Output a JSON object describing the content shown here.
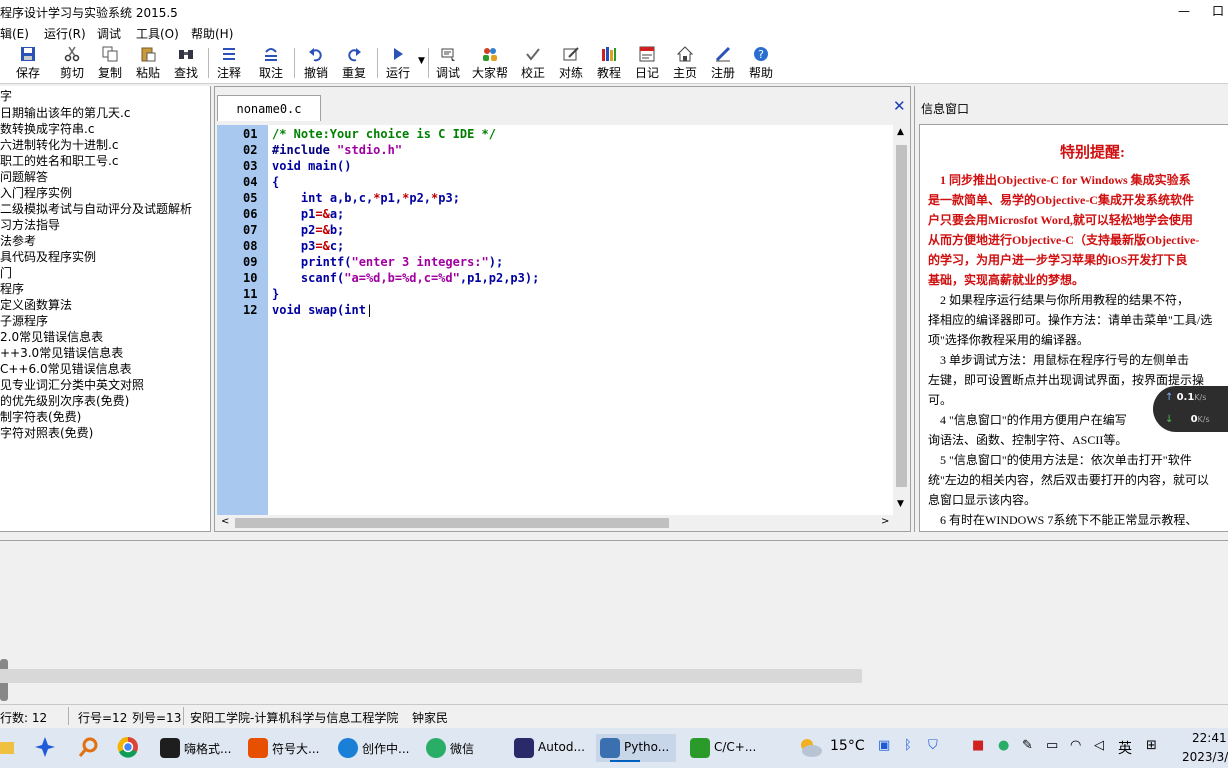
{
  "window": {
    "title": "程序设计学习与实验系统 2015.5",
    "min": "—",
    "max": "口"
  },
  "menu": [
    "辑(E)",
    "运行(R)",
    "调试",
    "工具(O)",
    "帮助(H)"
  ],
  "toolbar": [
    {
      "label": "保存",
      "icon": "save-icon"
    },
    {
      "label": "剪切",
      "icon": "cut-icon"
    },
    {
      "label": "复制",
      "icon": "copy-icon"
    },
    {
      "label": "粘贴",
      "icon": "paste-icon"
    },
    {
      "label": "查找",
      "icon": "find-icon"
    },
    {
      "label": "注释",
      "icon": "comment-icon"
    },
    {
      "label": "取注",
      "icon": "uncomment-icon"
    },
    {
      "label": "撤销",
      "icon": "undo-icon"
    },
    {
      "label": "重复",
      "icon": "redo-icon"
    },
    {
      "label": "运行",
      "icon": "run-icon"
    },
    {
      "label": "调试",
      "icon": "debug-icon"
    },
    {
      "label": "大家帮",
      "icon": "people-icon"
    },
    {
      "label": "校正",
      "icon": "check-icon"
    },
    {
      "label": "对练",
      "icon": "practice-icon"
    },
    {
      "label": "教程",
      "icon": "books-icon"
    },
    {
      "label": "日记",
      "icon": "diary-icon"
    },
    {
      "label": "主页",
      "icon": "home-icon"
    },
    {
      "label": "注册",
      "icon": "register-icon"
    },
    {
      "label": "帮助",
      "icon": "help-icon"
    }
  ],
  "tree": [
    "字",
    "日期输出该年的第几天.c",
    "数转换成字符串.c",
    "六进制转化为十进制.c",
    "职工的姓名和职工号.c",
    "问题解答",
    "入门程序实例",
    "二级模拟考试与自动评分及试题解析",
    "习方法指导",
    "法参考",
    "具代码及程序实例",
    "门",
    "程序",
    "定义函数算法",
    "子源程序",
    "2.0常见错误信息表",
    "++3.0常见错误信息表",
    "C++6.0常见错误信息表",
    "见专业词汇分类中英文对照",
    "的优先级别次序表(免费)",
    "制字符表(免费)",
    "字符对照表(免费)"
  ],
  "editor": {
    "tab": "noname0.c",
    "close": "✕",
    "lines": [
      {
        "n": "01",
        "html": "<span class=\"cm\">/* Note:Your choice is C IDE */</span>"
      },
      {
        "n": "02",
        "html": "<span class=\"pp\">#include</span> <span class=\"str\">\"stdio.h\"</span>"
      },
      {
        "n": "03",
        "html": "<span class=\"kw\">void</span> <span class=\"kw\">main</span><span class=\"kw\">()</span>"
      },
      {
        "n": "04",
        "html": "<span class=\"kw\">{</span>"
      },
      {
        "n": "05",
        "html": "    <span class=\"kw\">int</span> <span class=\"kw\">a,b,c,</span><span class=\"op\">*</span><span class=\"kw\">p1,</span><span class=\"op\">*</span><span class=\"kw\">p2,</span><span class=\"op\">*</span><span class=\"kw\">p3;</span>"
      },
      {
        "n": "06",
        "html": "    <span class=\"kw\">p1</span><span class=\"op\">=&amp;</span><span class=\"kw\">a;</span>"
      },
      {
        "n": "07",
        "html": "    <span class=\"kw\">p2</span><span class=\"op\">=&amp;</span><span class=\"kw\">b;</span>"
      },
      {
        "n": "08",
        "html": "    <span class=\"kw\">p3</span><span class=\"op\">=&amp;</span><span class=\"kw\">c;</span>"
      },
      {
        "n": "09",
        "html": "    <span class=\"kw\">printf(</span><span class=\"str\">\"enter 3 integers:\"</span><span class=\"kw\">);</span>"
      },
      {
        "n": "10",
        "html": "    <span class=\"kw\">scanf(</span><span class=\"str\">\"a=%d,b=%d,c=%d\"</span><span class=\"kw\">,p1,p2,p3);</span>"
      },
      {
        "n": "11",
        "html": "<span class=\"kw\">}</span>"
      },
      {
        "n": "12",
        "html": "<span class=\"kw\">void swap(int</span><span style=\"color:#000;font-weight:normal\">|</span>"
      }
    ]
  },
  "info": {
    "header": "信息窗口",
    "heading": "特别提醒:",
    "paras": [
      {
        "red": true,
        "text": "　1 同步推出Objective-C for Windows 集成实验系"
      },
      {
        "red": true,
        "text": "是一款简单、易学的Objective-C集成开发系统软件"
      },
      {
        "red": true,
        "text": "户只要会用Microsfot Word,就可以轻松地学会使用"
      },
      {
        "red": true,
        "text": "从而方便地进行Objective-C（支持最新版Objective-"
      },
      {
        "red": true,
        "text": "的学习，为用户进一步学习苹果的iOS开发打下良"
      },
      {
        "red": true,
        "text": "基础，实现高薪就业的梦想。"
      },
      {
        "red": false,
        "text": "　2 如果程序运行结果与你所用教程的结果不符，"
      },
      {
        "red": false,
        "text": "择相应的编译器即可。操作方法：请单击菜单\"工具/选"
      },
      {
        "red": false,
        "text": "项\"选择你教程采用的编译器。"
      },
      {
        "red": false,
        "text": "　3 单步调试方法：用鼠标在程序行号的左侧单击"
      },
      {
        "red": false,
        "text": "左键，即可设置断点并出现调试界面，按界面提示操"
      },
      {
        "red": false,
        "text": "可。"
      },
      {
        "red": false,
        "text": "　4 \"信息窗口\"的作用方便用户在编写"
      },
      {
        "red": false,
        "text": "询语法、函数、控制字符、ASCII等。"
      },
      {
        "red": false,
        "text": "　5 \"信息窗口\"的使用方法是：依次单击打开\"软件"
      },
      {
        "red": false,
        "text": "统\"左边的相关内容，然后双击要打开的内容，就可以"
      },
      {
        "red": false,
        "text": "息窗口显示该内容。"
      },
      {
        "red": false,
        "text": "　6 有时在WINDOWS 7系统下不能正常显示教程、"
      }
    ]
  },
  "net": {
    "up": "0.1",
    "down": "0",
    "unit": "K/s"
  },
  "status": {
    "lines": "行数:  12",
    "row": "行号=12",
    "col": "列号=13",
    "org": "安阳工学院-计算机科学与信息工程学院",
    "author": "钟家民"
  },
  "taskbar": {
    "items": [
      {
        "label": "嗨格式...",
        "color": "#1e1e1e"
      },
      {
        "label": "符号大...",
        "color": "#e65000"
      },
      {
        "label": "创作中...",
        "color": "#1a7fd6"
      },
      {
        "label": "微信",
        "color": "#2aae67"
      },
      {
        "label": "Autod...",
        "color": "#2a2a6a"
      },
      {
        "label": "Pytho...",
        "color": "#3a6fb0"
      },
      {
        "label": "C/C+...",
        "color": "#2a9a2a"
      }
    ],
    "weather": "15°C",
    "lang": "英",
    "time": "22:41",
    "date": "2023/3/"
  },
  "colors": {
    "accent": "#0060c0",
    "gutter": "#a8c8f0",
    "red": "#d01010"
  }
}
